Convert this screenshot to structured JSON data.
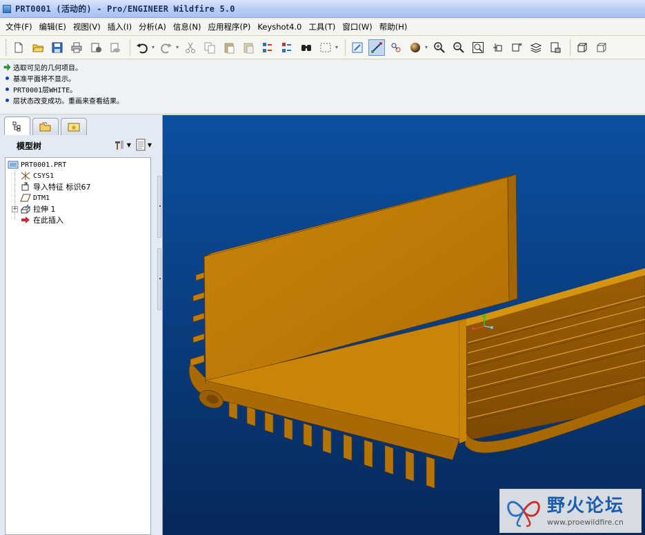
{
  "window": {
    "title": "PRT0001 (活动的) - Pro/ENGINEER Wildfire 5.0"
  },
  "menu": [
    {
      "label": "文件(F)"
    },
    {
      "label": "编辑(E)"
    },
    {
      "label": "视图(V)"
    },
    {
      "label": "插入(I)"
    },
    {
      "label": "分析(A)"
    },
    {
      "label": "信息(N)"
    },
    {
      "label": "应用程序(P)"
    },
    {
      "label": "Keyshot4.0"
    },
    {
      "label": "工具(T)"
    },
    {
      "label": "窗口(W)"
    },
    {
      "label": "帮助(H)"
    }
  ],
  "toolbar": {
    "buttons": [
      "new-icon",
      "open-icon",
      "save-icon",
      "print-icon",
      "send-icon",
      "mail-icon",
      "undo-icon",
      "redo-icon",
      "cut-icon",
      "copy-icon",
      "paste-icon",
      "paste-special-icon",
      "regenerate-icon",
      "regen-manager-icon",
      "find-icon",
      "select-box-icon",
      "repaint-icon",
      "orient-icon",
      "saved-views-icon",
      "appearance-icon",
      "zoom-in-icon",
      "zoom-out-icon",
      "refit-icon",
      "reorient-icon",
      "named-views-icon",
      "layers-icon",
      "view-manager-icon",
      "wireframe-icon",
      "hidden-line-icon"
    ]
  },
  "messages": [
    {
      "type": "arrow",
      "text": "选取可见的几何项目。"
    },
    {
      "type": "dot",
      "text": "基准平面将不显示。"
    },
    {
      "type": "dot",
      "text": "PRT0001层WHITE。"
    },
    {
      "type": "dot",
      "text": "层状态改变成功。重画来查看结果。"
    }
  ],
  "model_tree": {
    "title": "模型树",
    "items": [
      {
        "label": "PRT0001.PRT",
        "icon": "part-icon"
      },
      {
        "label": "CSYS1",
        "icon": "csys-icon"
      },
      {
        "label": "导入特征 标识67",
        "icon": "import-feature-icon"
      },
      {
        "label": "DTM1",
        "icon": "datum-plane-icon"
      },
      {
        "label": "拉伸 1",
        "icon": "extrude-icon",
        "expandable": true,
        "expander": "+"
      },
      {
        "label": "在此插入",
        "icon": "insert-here-icon"
      }
    ]
  },
  "colors": {
    "part": "#c07c07",
    "viewport_top": "#0b50a0",
    "viewport_bottom": "#06285a"
  },
  "watermark": {
    "title": "野火论坛",
    "url": "www.proewildfire.cn"
  }
}
